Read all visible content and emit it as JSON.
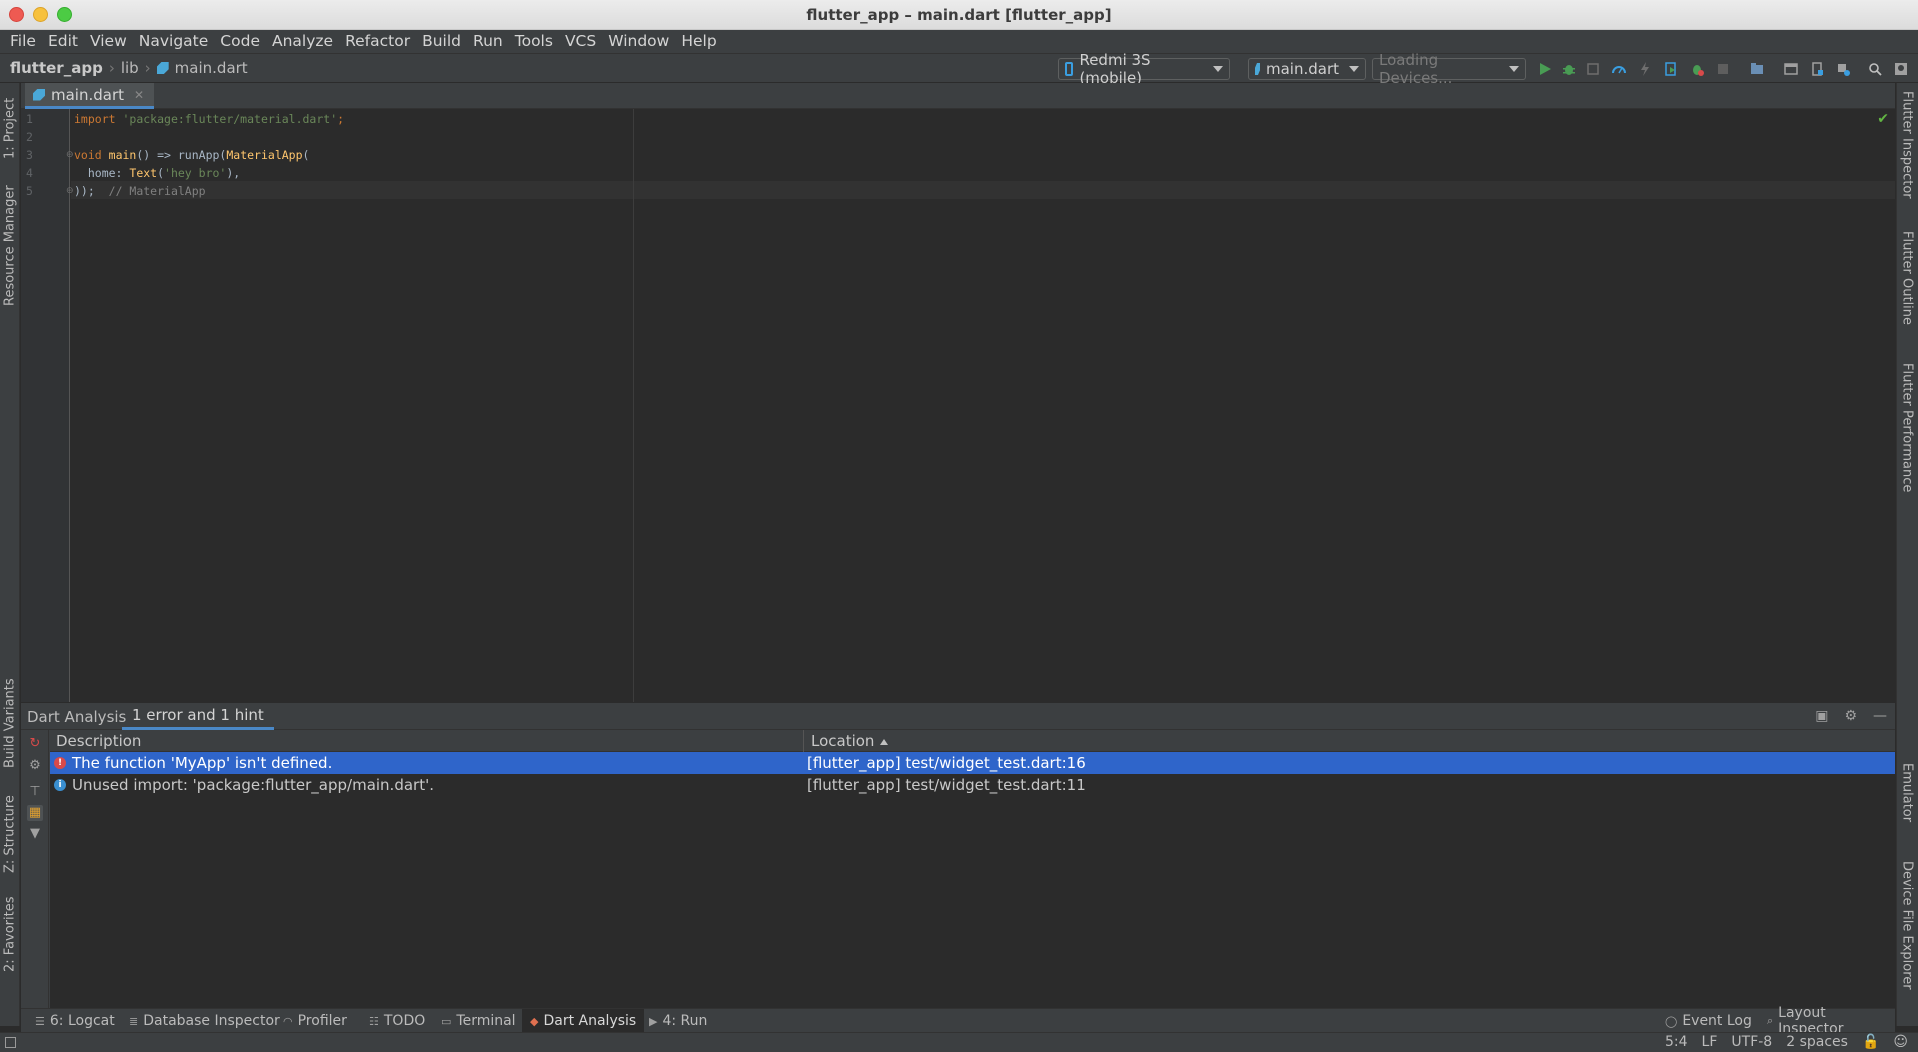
{
  "window": {
    "title": "flutter_app – main.dart [flutter_app]"
  },
  "menu": [
    "File",
    "Edit",
    "View",
    "Navigate",
    "Code",
    "Analyze",
    "Refactor",
    "Build",
    "Run",
    "Tools",
    "VCS",
    "Window",
    "Help"
  ],
  "breadcrumb": {
    "project": "flutter_app",
    "folder": "lib",
    "file": "main.dart"
  },
  "toolbar": {
    "device": "Redmi 3S (mobile)",
    "run_config": "main.dart",
    "devices_status": "Loading Devices..."
  },
  "left_tabs": [
    "1: Project",
    "Resource Manager",
    "Build Variants",
    "Z: Structure",
    "2: Favorites"
  ],
  "right_tabs": [
    "Flutter Inspector",
    "Flutter Outline",
    "Flutter Performance",
    "Emulator",
    "Device File Explorer"
  ],
  "editor": {
    "tab": "main.dart",
    "lines": [
      "1",
      "2",
      "3",
      "4",
      "5"
    ],
    "code": {
      "l1_kw": "import",
      "l1_str": "'package:flutter/material.dart'",
      "l1_end": ";",
      "l3_kw": "void",
      "l3_fn": "main",
      "l3_rest": "() => runApp(",
      "l3_cls": "MaterialApp",
      "l3_end": "(",
      "l4_prefix": "  home: ",
      "l4_cls": "Text",
      "l4_open": "(",
      "l4_str": "'hey bro'",
      "l4_end": "),",
      "l5_code": "));",
      "l5_comment": "// MaterialApp"
    }
  },
  "analysis": {
    "title": "Dart Analysis",
    "tab": "1 error and 1 hint",
    "columns": {
      "description": "Description",
      "location": "Location"
    },
    "rows": [
      {
        "severity": "error",
        "description": "The function 'MyApp' isn't defined.",
        "location": "[flutter_app] test/widget_test.dart:16"
      },
      {
        "severity": "info",
        "description": "Unused import: 'package:flutter_app/main.dart'.",
        "location": "[flutter_app] test/widget_test.dart:11"
      }
    ]
  },
  "bottom_tools": {
    "logcat": "6: Logcat",
    "database": "Database Inspector",
    "profiler": "Profiler",
    "todo": "TODO",
    "terminal": "Terminal",
    "dart_analysis": "Dart Analysis",
    "run": "4: Run",
    "event_log": "Event Log",
    "layout_inspector": "Layout Inspector"
  },
  "status": {
    "position": "5:4",
    "line_sep": "LF",
    "encoding": "UTF-8",
    "indent": "2 spaces"
  },
  "colors": {
    "accent": "#4a88c7",
    "selection": "#2f65ca",
    "error": "#d84a4a",
    "info": "#3a8fd0",
    "run_green": "#499c54"
  }
}
